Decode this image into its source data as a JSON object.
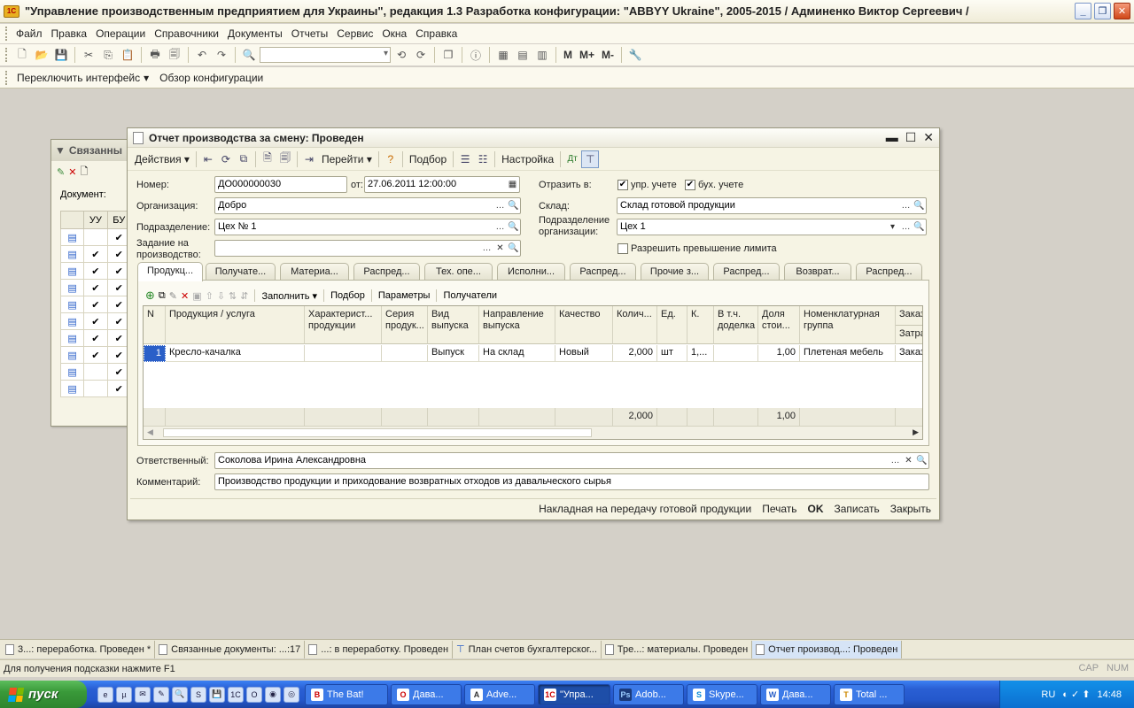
{
  "app": {
    "title": "\"Управление производственным предприятием для Украины\", редакция 1.3 Разработка конфигурации: \"ABBYY Ukraine\", 2005-2015 / Админенко Виктор Сергеевич /",
    "logo": "1С"
  },
  "menu": [
    "Файл",
    "Правка",
    "Операции",
    "Справочники",
    "Документы",
    "Отчеты",
    "Сервис",
    "Окна",
    "Справка"
  ],
  "toolbar": {
    "m": "M",
    "mplus": "M+",
    "mminus": "M-"
  },
  "toolbar2": {
    "switch_interface": "Переключить интерфейс",
    "config_overview": "Обзор конфигурации"
  },
  "bg_window": {
    "title": "Связанны",
    "doc_label": "Документ:",
    "cols": [
      "УУ",
      "БУ"
    ],
    "rows": [
      [
        "",
        "✔"
      ],
      [
        "✔",
        "✔"
      ],
      [
        "✔",
        "✔"
      ],
      [
        "✔",
        "✔"
      ],
      [
        "✔",
        "✔"
      ],
      [
        "✔",
        "✔"
      ],
      [
        "✔",
        "✔"
      ],
      [
        "✔",
        "✔"
      ],
      [
        "",
        "✔"
      ],
      [
        "",
        "✔"
      ]
    ]
  },
  "doc": {
    "title": "Отчет производства за смену: Проведен",
    "toolbar": {
      "actions": "Действия",
      "goto": "Перейти",
      "select": "Подбор",
      "settings": "Настройка"
    },
    "labels": {
      "number": "Номер:",
      "from": "от:",
      "org": "Организация:",
      "division": "Подразделение:",
      "task_line1": "Задание на",
      "task_line2": "производство:",
      "reflect": "Отразить в:",
      "mgmt": "упр. учете",
      "acc": "бух. учете",
      "warehouse": "Склад:",
      "org_div_line1": "Подразделение",
      "org_div_line2": "организации:",
      "allow_limit": "Разрешить превышение лимита",
      "responsible": "Ответственный:",
      "comment": "Комментарий:"
    },
    "values": {
      "number": "ДО000000030",
      "date": "27.06.2011 12:00:00",
      "org": "Добро",
      "division": "Цех № 1",
      "task": "",
      "warehouse": "Склад готовой продукции",
      "org_division": "Цех 1",
      "responsible": "Соколова Ирина Александровна",
      "comment": "Производство продукции и приходование возвратных отходов из давальческого сырья"
    },
    "tabs": [
      "Продукц...",
      "Получате...",
      "Материа...",
      "Распред...",
      "Тех. опе...",
      "Исполни...",
      "Распред...",
      "Прочие з...",
      "Распред...",
      "Возврат...",
      "Распред..."
    ],
    "grid_toolbar": {
      "fill": "Заполнить",
      "select": "Подбор",
      "params": "Параметры",
      "recipients": "Получатели"
    },
    "grid": {
      "headers": [
        "N",
        "Продукция / услуга",
        "Характерист... продукции",
        "Серия продук...",
        "Вид выпуска",
        "Направление выпуска",
        "Качество",
        "Колич...",
        "Ед.",
        "К.",
        "В т.ч. доделка",
        "Доля стои...",
        "Номенклатурная группа",
        "Заказ",
        "Затра"
      ],
      "row": [
        "1",
        "Кресло-качалка",
        "",
        "",
        "Выпуск",
        "На склад",
        "Новый",
        "2,000",
        "шт",
        "1,...",
        "",
        "1,00",
        "Плетеная мебель",
        "Заказ"
      ],
      "totals": {
        "qty": "2,000",
        "share": "1,00"
      }
    },
    "bottom": {
      "invoice": "Накладная на передачу готовой продукции",
      "print": "Печать",
      "ok": "OK",
      "save": "Записать",
      "close": "Закрыть"
    }
  },
  "mdi_tabs": [
    "3...: переработка. Проведен *",
    "Связанные документы: ...:17",
    "...: в переработку. Проведен",
    "План счетов бухгалтерског...",
    "Тре...: материалы. Проведен",
    "Отчет производ...: Проведен"
  ],
  "status": {
    "hint": "Для получения подсказки нажмите F1",
    "cap": "CAP",
    "num": "NUM"
  },
  "taskbar": {
    "start": "пуск",
    "tasks": [
      "The Bat!",
      "Дава...",
      "Adve...",
      "\"Упра...",
      "Adob...",
      "Skype...",
      "Дава...",
      "Total ..."
    ],
    "lang": "RU",
    "clock": "14:48"
  }
}
